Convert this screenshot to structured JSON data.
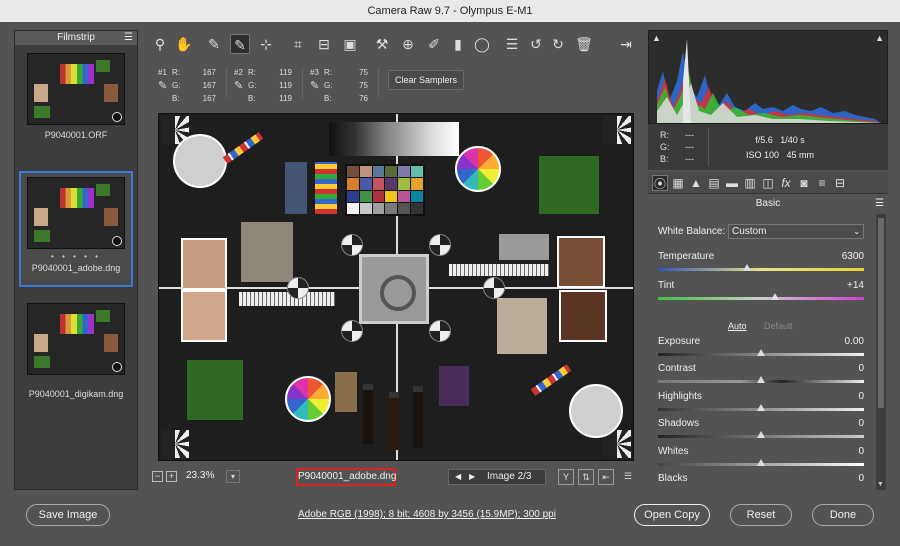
{
  "window": {
    "title": "Camera Raw 9.7  -  Olympus E-M1"
  },
  "filmstrip": {
    "header": "Filmstrip",
    "items": [
      {
        "caption": "P9040001.ORF"
      },
      {
        "caption": "P9040001_adobe.dng",
        "dots": "• • • • •"
      },
      {
        "caption": "P9040001_digikam.dng"
      }
    ]
  },
  "toolbar": {
    "icons": [
      "zoom-icon",
      "hand-icon",
      "white-balance-icon",
      "color-sampler-icon",
      "targeted-adjustment-icon",
      "crop-icon",
      "straighten-icon",
      "transform-icon",
      "spot-removal-icon",
      "red-eye-icon",
      "adjustment-brush-icon",
      "graduated-filter-icon",
      "radial-filter-icon",
      "preferences-icon",
      "rotate-left-icon",
      "rotate-right-icon",
      "trash-icon",
      "workflow-icon"
    ]
  },
  "samplers": [
    {
      "num": "#1",
      "r": "167",
      "g": "167",
      "b": "167"
    },
    {
      "num": "#2",
      "r": "119",
      "g": "119",
      "b": "119"
    },
    {
      "num": "#3",
      "r": "75",
      "g": "75",
      "b": "76"
    }
  ],
  "samplers_labels": {
    "r": "R:",
    "g": "G:",
    "b": "B:"
  },
  "clear_samplers": "Clear Samplers",
  "preview": {
    "zoom": "23.3%",
    "filename": "P9040001_adobe.dng",
    "image_nav": "Image 2/3"
  },
  "readout": {
    "r": "---",
    "g": "---",
    "b": "---",
    "labels": {
      "r": "R:",
      "g": "G:",
      "b": "B:"
    },
    "aperture": "f/5.6",
    "shutter": "1/40 s",
    "iso": "ISO 100",
    "focal": "45 mm"
  },
  "panel": {
    "title": "Basic",
    "white_balance_label": "White Balance:",
    "white_balance_value": "Custom",
    "auto": "Auto",
    "default": "Default",
    "sliders": [
      {
        "label": "Temperature",
        "value": "6300",
        "fraction": 0.43
      },
      {
        "label": "Tint",
        "value": "+14",
        "fraction": 0.57
      },
      {
        "label": "Exposure",
        "value": "0.00",
        "fraction": 0.5
      },
      {
        "label": "Contrast",
        "value": "0",
        "fraction": 0.5
      },
      {
        "label": "Highlights",
        "value": "0",
        "fraction": 0.5
      },
      {
        "label": "Shadows",
        "value": "0",
        "fraction": 0.5
      },
      {
        "label": "Whites",
        "value": "0",
        "fraction": 0.5
      },
      {
        "label": "Blacks",
        "value": "0",
        "fraction": 0.5
      }
    ]
  },
  "footer": {
    "save": "Save Image",
    "status": "Adobe RGB (1998); 8 bit; 4608 by 3456 (15.9MP); 300 ppi",
    "open": "Open Copy",
    "reset": "Reset",
    "done": "Done"
  },
  "colors": {
    "accent": "#3a7ad6",
    "highlight_box": "#d22222"
  }
}
